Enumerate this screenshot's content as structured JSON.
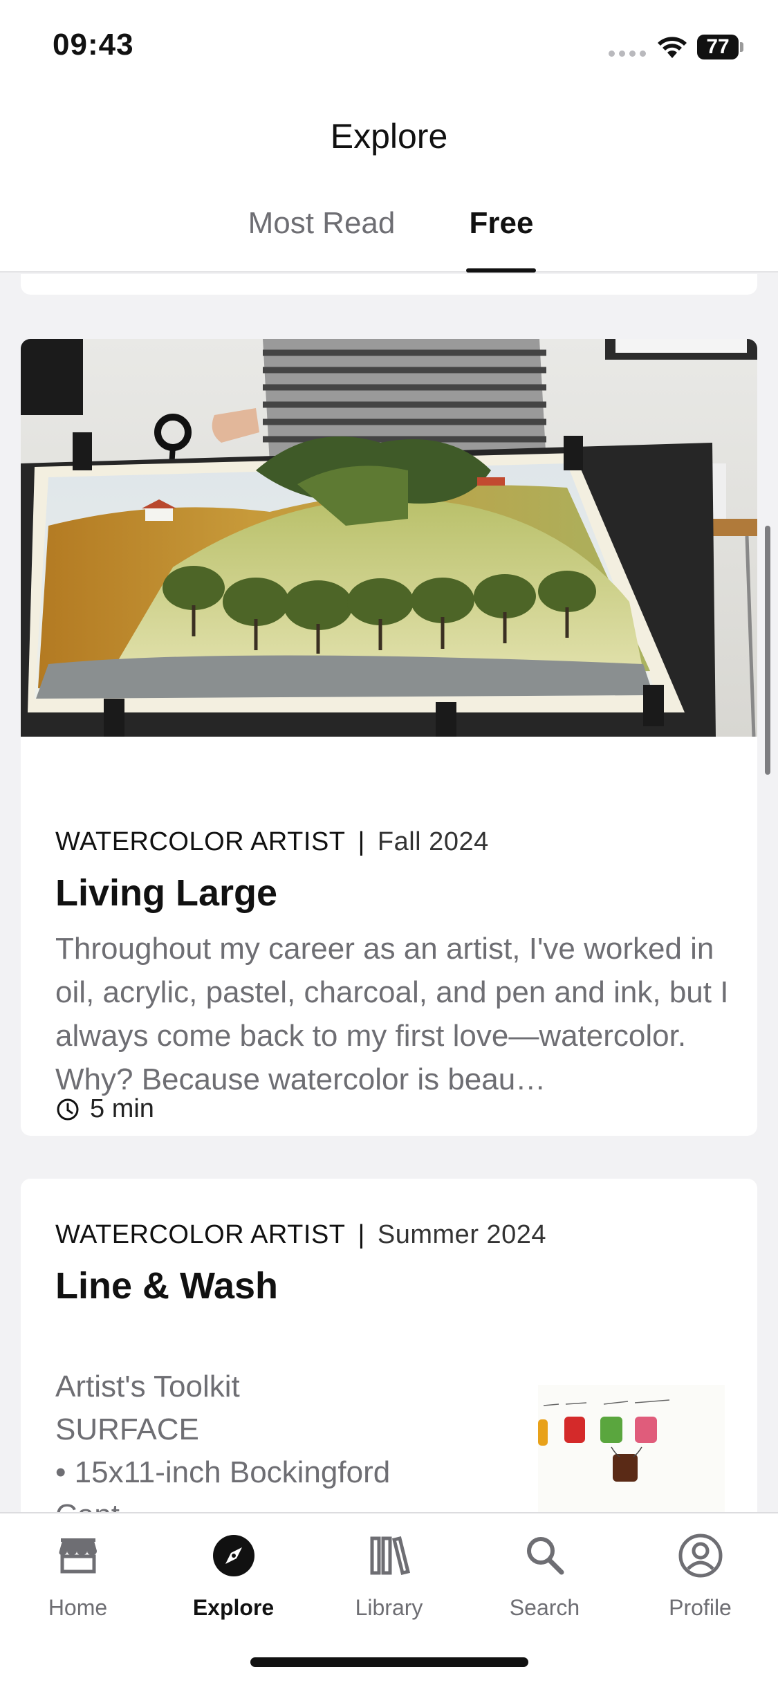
{
  "status_bar": {
    "time": "09:43",
    "battery": "77"
  },
  "header": {
    "title": "Explore",
    "tabs": [
      {
        "label": "Most Read",
        "active": false
      },
      {
        "label": "Free",
        "active": true
      }
    ]
  },
  "articles": [
    {
      "publication": "WATERCOLOR ARTIST",
      "separator": "|",
      "issue": "Fall 2024",
      "title": "Living Large",
      "excerpt": "Throughout my career as an artist, I've worked in oil, acrylic, pastel, charcoal, and pen and ink, but I always come back to my first love—watercolor. Why? Because watercolor is beau…",
      "read_time": "5 min",
      "image": "watercolor-vineyard-painting-photo"
    },
    {
      "publication": "WATERCOLOR ARTIST",
      "separator": "|",
      "issue": "Summer 2024",
      "title": "Line & Wash",
      "preview_lines": [
        "Artist's Toolkit",
        "SURFACE",
        "• 15x11-inch Bockingford",
        "Cant..."
      ],
      "image": "color-swatch-sketch"
    }
  ],
  "bottom_nav": {
    "items": [
      {
        "label": "Home",
        "icon": "home-icon",
        "active": false
      },
      {
        "label": "Explore",
        "icon": "compass-icon",
        "active": true
      },
      {
        "label": "Library",
        "icon": "library-icon",
        "active": false
      },
      {
        "label": "Search",
        "icon": "search-icon",
        "active": false
      },
      {
        "label": "Profile",
        "icon": "profile-icon",
        "active": false
      }
    ]
  },
  "colors": {
    "accent": "#111111",
    "muted_text": "#6e6e73",
    "background": "#f2f2f4"
  }
}
